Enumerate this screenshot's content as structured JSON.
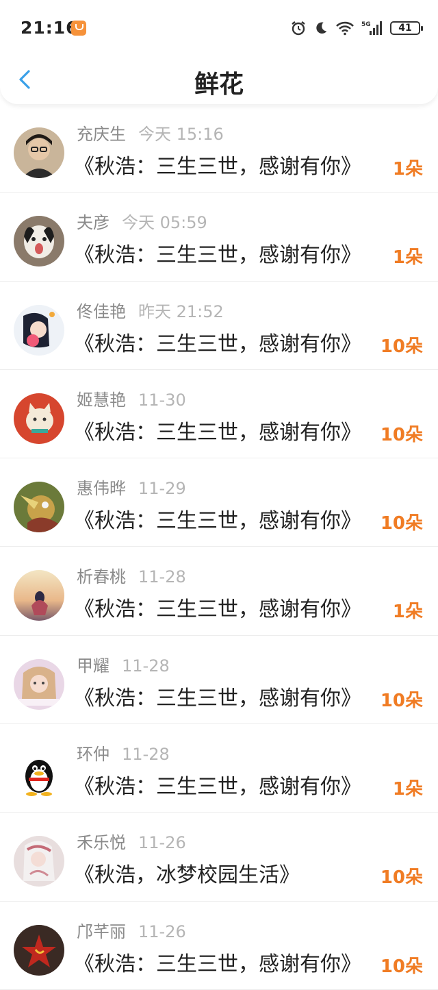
{
  "status_bar": {
    "time": "21:16",
    "battery": "41",
    "network": "5G"
  },
  "header": {
    "title": "鲜花"
  },
  "items": [
    {
      "name": "充庆生",
      "date": "今天 15:16",
      "content": "《秋浩：三生三世，感谢有你》",
      "count": "1朵"
    },
    {
      "name": "夫彦",
      "date": "今天 05:59",
      "content": "《秋浩：三生三世，感谢有你》",
      "count": "1朵"
    },
    {
      "name": "佟佳艳",
      "date": "昨天 21:52",
      "content": "《秋浩：三生三世，感谢有你》",
      "count": "10朵"
    },
    {
      "name": "姬慧艳",
      "date": "11-30",
      "content": "《秋浩：三生三世，感谢有你》",
      "count": "10朵"
    },
    {
      "name": "惠伟晔",
      "date": "11-29",
      "content": "《秋浩：三生三世，感谢有你》",
      "count": "10朵"
    },
    {
      "name": "析春桃",
      "date": "11-28",
      "content": "《秋浩：三生三世，感谢有你》",
      "count": "1朵"
    },
    {
      "name": "甲耀",
      "date": "11-28",
      "content": "《秋浩：三生三世，感谢有你》",
      "count": "10朵"
    },
    {
      "name": "环仲",
      "date": "11-28",
      "content": "《秋浩：三生三世，感谢有你》",
      "count": "1朵"
    },
    {
      "name": "禾乐悦",
      "date": "11-26",
      "content": "《秋浩，冰梦校园生活》",
      "count": "10朵"
    },
    {
      "name": "邝芊丽",
      "date": "11-26",
      "content": "《秋浩：三生三世，感谢有你》",
      "count": "10朵"
    }
  ],
  "colors": {
    "accent": "#f07c24",
    "back_icon": "#3aa0e8"
  }
}
